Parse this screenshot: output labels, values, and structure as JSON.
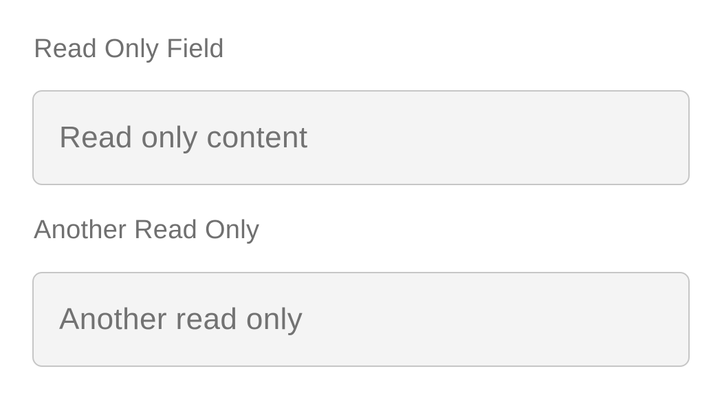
{
  "fields": [
    {
      "label": "Read Only Field",
      "value": "Read only content",
      "readonly": true
    },
    {
      "label": "Another Read Only",
      "value": "Another read only",
      "readonly": true
    }
  ],
  "colors": {
    "label_text": "#707070",
    "value_text": "#727272",
    "field_background": "#f4f4f4",
    "field_border": "#c6c6c6",
    "page_background": "#ffffff"
  }
}
